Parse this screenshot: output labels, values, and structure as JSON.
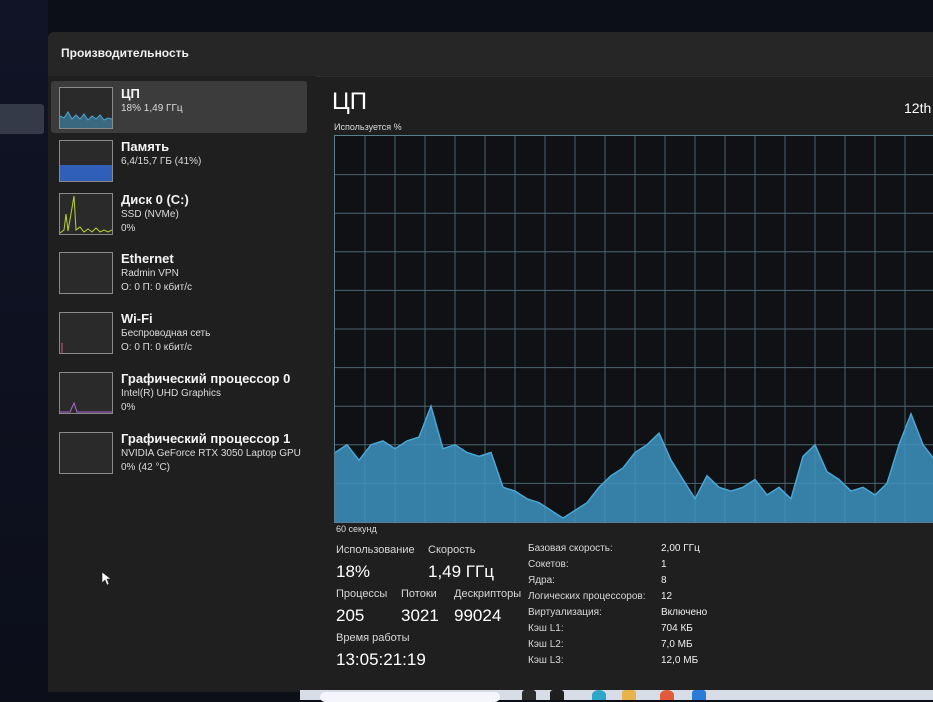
{
  "window": {
    "title": "Производительность"
  },
  "sidebar": {
    "items": [
      {
        "name": "ЦП",
        "sub1": "18%  1,49 ГГц",
        "sub2": "",
        "icon": "cpu-graph-thumbnail",
        "active": true
      },
      {
        "name": "Память",
        "sub1": "6,4/15,7 ГБ (41%)",
        "sub2": "",
        "icon": "memory-graph-thumbnail"
      },
      {
        "name": "Диск 0 (C:)",
        "sub1": "SSD (NVMe)",
        "sub2": "0%",
        "icon": "disk-graph-thumbnail"
      },
      {
        "name": "Ethernet",
        "sub1": "Radmin VPN",
        "sub2": "О: 0 П: 0 кбит/с",
        "icon": "ethernet-graph-thumbnail"
      },
      {
        "name": "Wi-Fi",
        "sub1": "Беспроводная сеть",
        "sub2": "О: 0 П: 0 кбит/с",
        "icon": "wifi-graph-thumbnail"
      },
      {
        "name": "Графический процессор 0",
        "sub1": "Intel(R) UHD Graphics",
        "sub2": "0%",
        "icon": "gpu0-graph-thumbnail"
      },
      {
        "name": "Графический процессор 1",
        "sub1": "NVIDIA GeForce RTX 3050 Laptop GPU",
        "sub2": "0% (42 °C)",
        "icon": "gpu1-graph-thumbnail"
      }
    ]
  },
  "main": {
    "title": "ЦП",
    "cpu_model": "12th",
    "graph_caption": "Используется %",
    "graph_time": "60 секунд",
    "stats": {
      "usage_label": "Использование",
      "usage_value": "18%",
      "speed_label": "Скорость",
      "speed_value": "1,49 ГГц",
      "processes_label": "Процессы",
      "processes_value": "205",
      "threads_label": "Потоки",
      "threads_value": "3021",
      "handles_label": "Дескрипторы",
      "handles_value": "99024",
      "uptime_label": "Время работы",
      "uptime_value": "13:05:21:19"
    },
    "details": [
      {
        "label": "Базовая скорость:",
        "value": "2,00 ГГц"
      },
      {
        "label": "Сокетов:",
        "value": "1"
      },
      {
        "label": "Ядра:",
        "value": "8"
      },
      {
        "label": "Логических процессоров:",
        "value": "12"
      },
      {
        "label": "Виртуализация:",
        "value": "Включено"
      },
      {
        "label": "Кэш L1:",
        "value": "704 КБ"
      },
      {
        "label": "Кэш L2:",
        "value": "7,0 МБ"
      },
      {
        "label": "Кэш L3:",
        "value": "12,0 МБ"
      }
    ]
  },
  "colors": {
    "cpu_line": "#4aa6d4",
    "cpu_fill": "#3d93bf",
    "memory_fill": "#2f5fb8",
    "disk_line": "#bcd330",
    "gpu_line": "#b06ad8",
    "grid": "#4a6470"
  },
  "cpu_usage_history": [
    18,
    20,
    16,
    20,
    21,
    19,
    21,
    22,
    30,
    19,
    20,
    18,
    17,
    18,
    9,
    8,
    6,
    5,
    3,
    1,
    3,
    5,
    9,
    12,
    14,
    18,
    20,
    23,
    16,
    11,
    6,
    12,
    9,
    8,
    9,
    11,
    7,
    9,
    6,
    17,
    20,
    13,
    11,
    8,
    9,
    7,
    10,
    20,
    28,
    20,
    16
  ]
}
